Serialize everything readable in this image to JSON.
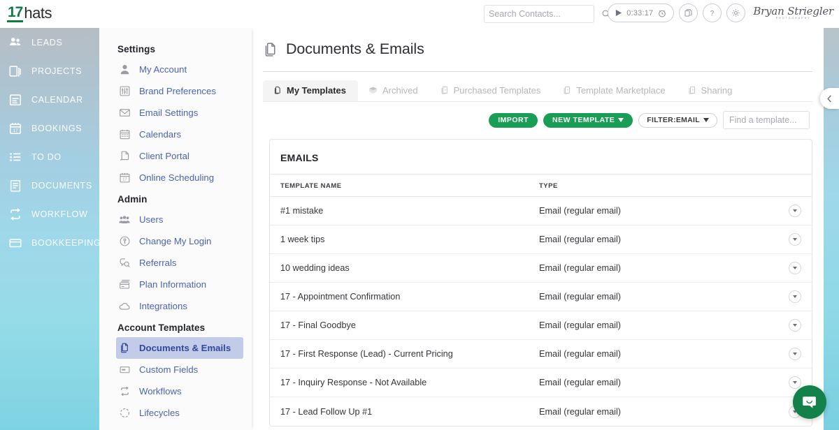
{
  "header": {
    "logo_17": "17",
    "logo_hats": "hats",
    "search": {
      "placeholder": "Search Contacts...",
      "value": ""
    },
    "timer": "0:33:17",
    "user_name": "Bryan Striegler",
    "user_sub": "PHOTOGRAPHY",
    "icons": [
      "play-icon",
      "alarm-clock-icon",
      "copy-icon",
      "help-icon",
      "gear-icon"
    ]
  },
  "leftnav": {
    "items": [
      {
        "label": "LEADS",
        "icon": "people-icon"
      },
      {
        "label": "PROJECTS",
        "icon": "layers-icon"
      },
      {
        "label": "CALENDAR",
        "icon": "calendar-icon"
      },
      {
        "label": "BOOKINGS",
        "icon": "calendar-17-icon"
      },
      {
        "label": "TO DO",
        "icon": "list-icon"
      },
      {
        "label": "DOCUMENTS",
        "icon": "document-icon"
      },
      {
        "label": "WORKFLOW",
        "icon": "loop-arrows-icon"
      },
      {
        "label": "BOOKKEEPING",
        "icon": "card-icon"
      }
    ]
  },
  "settings": {
    "sections": [
      {
        "title": "Settings",
        "items": [
          {
            "label": "My Account",
            "icon": "person-icon",
            "active": false
          },
          {
            "label": "Brand Preferences",
            "icon": "sliders-icon",
            "active": false
          },
          {
            "label": "Email Settings",
            "icon": "envelope-icon",
            "active": false
          },
          {
            "label": "Calendars",
            "icon": "calendar-grid-icon",
            "active": false
          },
          {
            "label": "Client Portal",
            "icon": "portal-icon",
            "active": false
          },
          {
            "label": "Online Scheduling",
            "icon": "calendar-17-icon",
            "active": false
          }
        ]
      },
      {
        "title": "Admin",
        "items": [
          {
            "label": "Users",
            "icon": "users-icon",
            "active": false
          },
          {
            "label": "Change My Login",
            "icon": "key-circle-icon",
            "active": false
          },
          {
            "label": "Referrals",
            "icon": "chat-search-icon",
            "active": false
          },
          {
            "label": "Plan Information",
            "icon": "credit-card-icon",
            "active": false
          },
          {
            "label": "Integrations",
            "icon": "cloud-icon",
            "active": false
          }
        ]
      },
      {
        "title": "Account Templates",
        "items": [
          {
            "label": "Documents & Emails",
            "icon": "documents-icon",
            "active": true
          },
          {
            "label": "Custom Fields",
            "icon": "field-icon",
            "active": false
          },
          {
            "label": "Workflows",
            "icon": "loop-arrows-icon",
            "active": false
          },
          {
            "label": "Lifecycles",
            "icon": "dashed-circle-icon",
            "active": false
          }
        ]
      }
    ]
  },
  "main": {
    "page_title": "Documents & Emails",
    "page_icon": "documents-icon",
    "tabs": [
      {
        "label": "My Templates",
        "icon": "document-icon",
        "active": true
      },
      {
        "label": "Archived",
        "icon": "archive-icon",
        "active": false
      },
      {
        "label": "Purchased Templates",
        "icon": "purchased-icon",
        "active": false
      },
      {
        "label": "Template Marketplace",
        "icon": "marketplace-icon",
        "active": false
      },
      {
        "label": "Sharing",
        "icon": "sharing-icon",
        "active": false
      }
    ],
    "toolbar": {
      "import_label": "IMPORT",
      "new_template_label": "NEW TEMPLATE",
      "filter_label": "FILTER:EMAIL",
      "find_placeholder": "Find a template...",
      "find_value": ""
    },
    "card": {
      "title": "EMAILS",
      "columns": {
        "name": "TEMPLATE NAME",
        "type": "TYPE"
      },
      "rows": [
        {
          "name": "#1 mistake",
          "type": "Email (regular email)"
        },
        {
          "name": "1 week tips",
          "type": "Email (regular email)"
        },
        {
          "name": "10 wedding ideas",
          "type": "Email (regular email)"
        },
        {
          "name": "17 - Appointment Confirmation",
          "type": "Email (regular email)"
        },
        {
          "name": "17 - Final Goodbye",
          "type": "Email (regular email)"
        },
        {
          "name": "17 - First Response (Lead) - Current Pricing",
          "type": "Email (regular email)"
        },
        {
          "name": "17 - Inquiry Response - Not Available",
          "type": "Email (regular email)"
        },
        {
          "name": "17 - Lead Follow Up #1",
          "type": "Email (regular email)"
        }
      ]
    }
  },
  "widgets": {
    "collapse_icon": "chevron-left-icon",
    "chat_icon": "chat-smile-icon"
  },
  "colors": {
    "brand_green": "#1a9e56",
    "logo_green": "#0f7b46",
    "link_blue": "#4a64b4",
    "active_bg": "#c2cbe8",
    "active_text": "#33479b",
    "chat_green": "#13824a"
  }
}
